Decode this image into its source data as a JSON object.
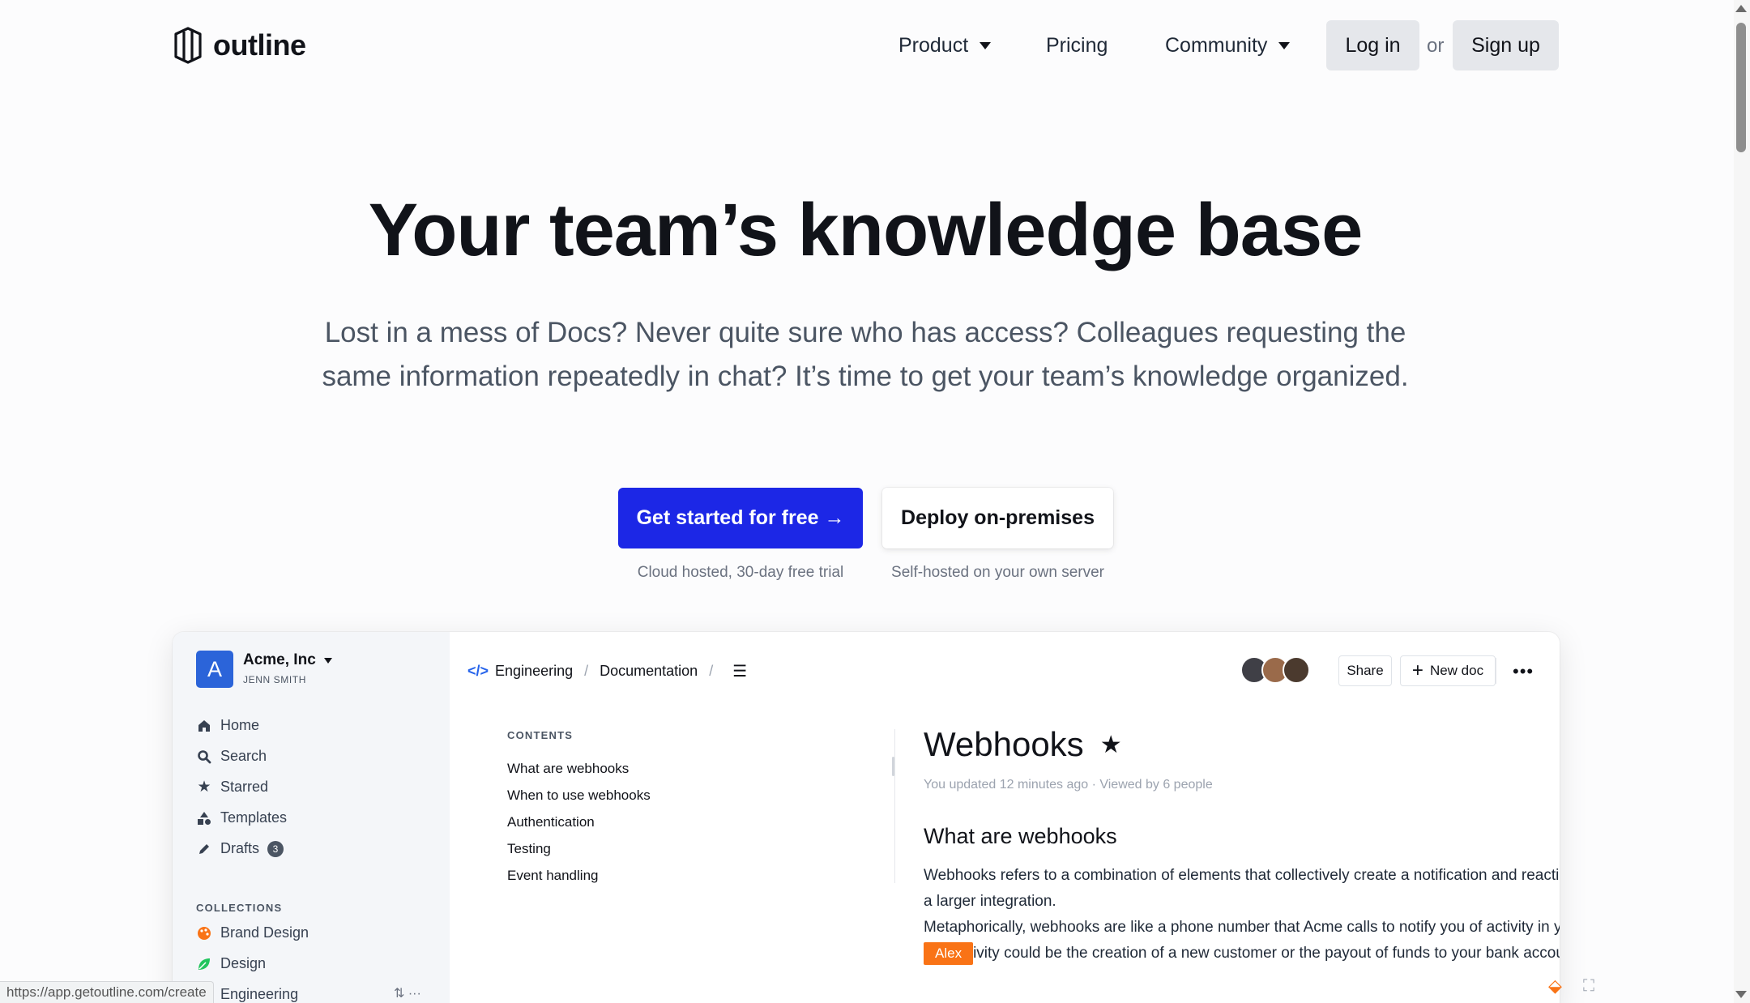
{
  "nav": {
    "logo_text": "outline",
    "links": {
      "product": "Product",
      "pricing": "Pricing",
      "community": "Community"
    },
    "login": "Log in",
    "or": "or",
    "signup": "Sign up"
  },
  "hero": {
    "title": "Your team’s knowledge base",
    "subtitle": "Lost in a mess of Docs? Never quite sure who has access? Colleagues requesting the same information repeatedly in chat? It’s time to get your team’s knowledge organized.",
    "cta_primary": "Get started for free →",
    "cta_primary_note": "Cloud hosted, 30-day free trial",
    "cta_secondary": "Deploy on-premises",
    "cta_secondary_note": "Self-hosted on your own server"
  },
  "app": {
    "team": {
      "avatar_letter": "A",
      "name": "Acme, Inc",
      "user": "JENN SMITH"
    },
    "sidebar_items": [
      {
        "label": "Home",
        "icon": "home-icon"
      },
      {
        "label": "Search",
        "icon": "search-icon"
      },
      {
        "label": "Starred",
        "icon": "star-icon"
      },
      {
        "label": "Templates",
        "icon": "shapes-icon"
      },
      {
        "label": "Drafts",
        "icon": "pencil-icon",
        "badge": "3"
      }
    ],
    "collections_heading": "COLLECTIONS",
    "collections": [
      {
        "label": "Brand Design",
        "color": "#f97316"
      },
      {
        "label": "Design",
        "color": "#22c55e"
      },
      {
        "label": "Engineering",
        "color": "#2563eb"
      }
    ],
    "breadcrumb": {
      "collection": "Engineering",
      "doc": "Documentation"
    },
    "share": "Share",
    "new_doc": "New doc",
    "contents_heading": "CONTENTS",
    "toc": [
      "What are webhooks",
      "When to use webhooks",
      "Authentication",
      "Testing",
      "Event handling"
    ],
    "doc": {
      "title": "Webhooks",
      "meta": "You updated 12 minutes ago · Viewed by 6 people",
      "h2": "What are webhooks",
      "p1": "Webhooks refers to a combination of elements that collectively create a notification and reaction system within a larger integration.",
      "p2_before": "Metaphorically, webhooks are like a phone number that Acme calls to notify you of activity in your account. ",
      "cursor_name": "Alex",
      "p2_after": "ivity could be the creation of a new customer or the payout of funds to your bank account."
    }
  },
  "status_url": "https://app.getoutline.com/create",
  "colors": {
    "primary": "#1c27e6",
    "cursor": "#f97316",
    "team_avatar": "#2b64d9"
  }
}
